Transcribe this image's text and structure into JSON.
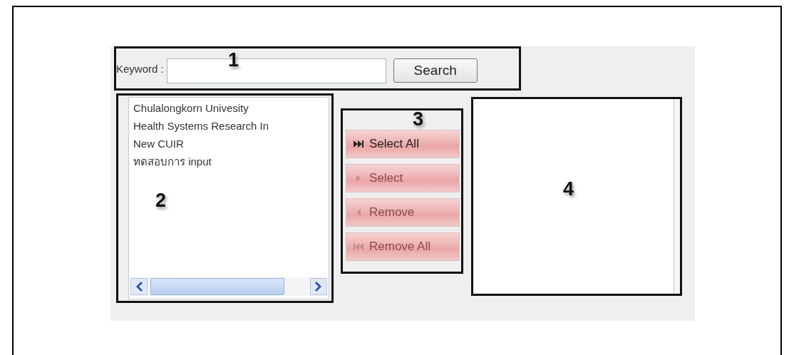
{
  "search": {
    "label": "Keyword :",
    "button": "Search",
    "callout": "1"
  },
  "source_list": {
    "items": [
      "Chulalongkorn Univesity",
      "Health Systems Research In",
      "New CUIR",
      "ทดสอบการ input"
    ],
    "callout": "2"
  },
  "transfer": {
    "callout": "3",
    "buttons": [
      {
        "kind": "select-all",
        "label": "Select All",
        "disabled": false
      },
      {
        "kind": "select",
        "label": "Select",
        "disabled": true
      },
      {
        "kind": "remove",
        "label": "Remove",
        "disabled": true
      },
      {
        "kind": "remove-all",
        "label": "Remove All",
        "disabled": true
      }
    ]
  },
  "target_list": {
    "callout": "4"
  }
}
